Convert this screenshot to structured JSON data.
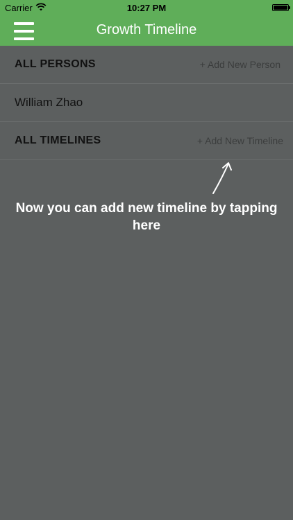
{
  "status_bar": {
    "carrier": "Carrier",
    "time": "10:27 PM",
    "wifi_icon": "wifi-icon",
    "battery_icon": "battery-icon"
  },
  "nav": {
    "title": "Growth Timeline",
    "menu_icon": "hamburger-menu-icon"
  },
  "sections": {
    "persons_header": "ALL PERSONS",
    "add_person": "+ Add New Person",
    "persons": [
      "William Zhao"
    ],
    "timelines_header": "ALL TIMELINES",
    "add_timeline": "+ Add New Timeline"
  },
  "tip": {
    "text": "Now you can add new timeline by tapping here",
    "arrow_icon": "arrow-up-icon"
  },
  "colors": {
    "nav_green": "#5fae59",
    "background": "#5c5f5f"
  }
}
